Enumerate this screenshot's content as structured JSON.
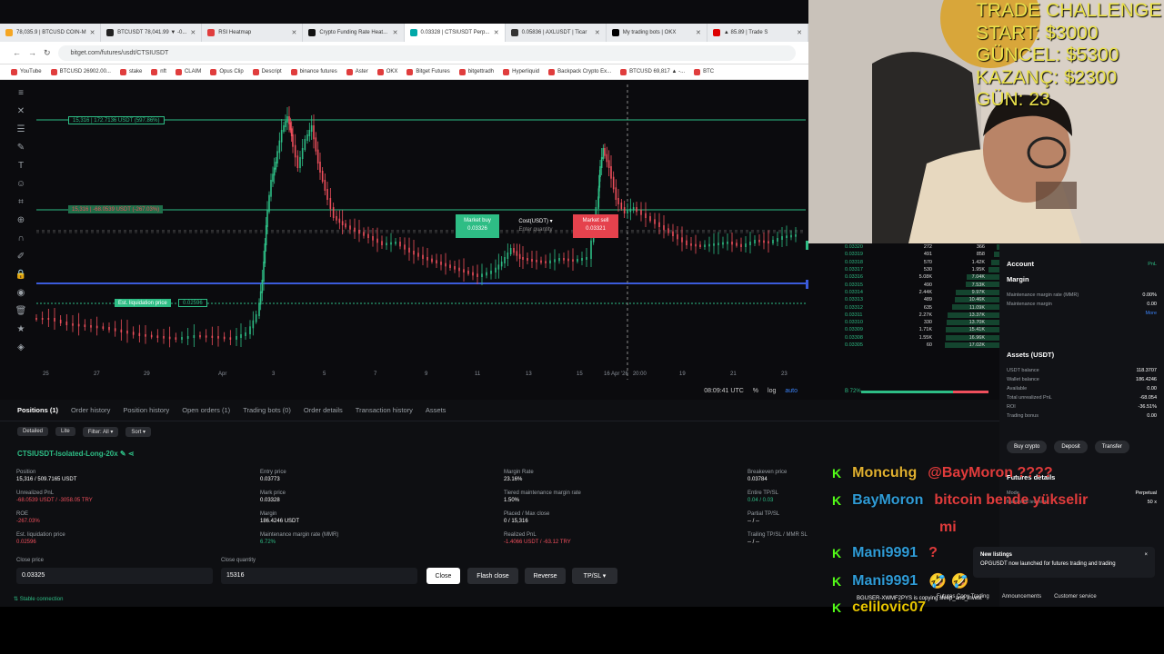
{
  "browser": {
    "tabs": [
      {
        "label": "78,035.9 | BTCUSD COIN-M",
        "color": "#f5a623"
      },
      {
        "label": "BTCUSDT 78,041.99 ▼ -0...",
        "color": "#222"
      },
      {
        "label": "RSI Heatmap",
        "color": "#e03d3d"
      },
      {
        "label": "Crypto Funding Rate Heat...",
        "color": "#111"
      },
      {
        "label": "0.03328 | CTSIUSDT Perp...",
        "color": "#00a8a8"
      },
      {
        "label": "0.05836 | AXLUSDT | Ticar",
        "color": "#333"
      },
      {
        "label": "My trading bots | OKX",
        "color": "#000"
      },
      {
        "label": "▲ 85.89 | Trade S",
        "color": "#d00"
      }
    ],
    "url": "bitget.com/futures/usdt/CTSIUSDT",
    "bookmarks": [
      "YouTube",
      "BTCUSD 26902.00...",
      "stake",
      "nft",
      "CLAIM",
      "Opus Clip",
      "Descript",
      "binance futures",
      "Aster",
      "OKX",
      "Bitget Futures",
      "bitgettradh",
      "Hyperliquid",
      "Backpack Crypto Ex...",
      "BTCUSD 69,817 ▲ -...",
      "BTC"
    ]
  },
  "chart": {
    "tp_tag": "15,316 | 172.7136 USDT (597.86%)",
    "sl_tag": "15,316 | -68.0539 USDT (-267.03%)",
    "liq_tag": "Est. liquidation price",
    "liq_value": "0.02596",
    "price_labels": [
      "0.03320",
      "0.03200",
      "0.02849",
      "0.02596",
      "0.02480",
      "0.02400",
      "0.02320",
      "0.02200"
    ],
    "x_labels": [
      "25",
      "27",
      "29",
      "Apr",
      "3",
      "5",
      "7",
      "9",
      "11",
      "13",
      "15",
      "16 Apr '26   20:00",
      "19",
      "21",
      "23"
    ],
    "market_buy": "Market buy",
    "market_buy_price": "0.03326",
    "cost_label": "Cost(USDT) ▾",
    "cost_placeholder": "Enter quantity",
    "market_sell": "Market sell",
    "market_sell_price": "0.03321",
    "time": "08:09:41 UTC",
    "pct": "%",
    "log": "log",
    "auto": "auto"
  },
  "orderbook": {
    "rows": [
      [
        "0.03320",
        "272",
        "366",
        0.05
      ],
      [
        "0.03319",
        "491",
        "858",
        0.1
      ],
      [
        "0.03318",
        "570",
        "1.42K",
        0.15
      ],
      [
        "0.03317",
        "530",
        "1.95K",
        0.2
      ],
      [
        "0.03316",
        "5.08K",
        "7.04K",
        0.6
      ],
      [
        "0.03315",
        "490",
        "7.53K",
        0.62
      ],
      [
        "0.03314",
        "2.44K",
        "9.97K",
        0.8
      ],
      [
        "0.03313",
        "489",
        "10.46K",
        0.82
      ],
      [
        "0.03312",
        "635",
        "11.09K",
        0.86
      ],
      [
        "0.03311",
        "2.27K",
        "13.37K",
        0.95
      ],
      [
        "0.03310",
        "330",
        "13.70K",
        0.96
      ],
      [
        "0.03309",
        "1.71K",
        "15.41K",
        0.98
      ],
      [
        "0.03308",
        "1.55K",
        "16.96K",
        0.99
      ],
      [
        "0.03305",
        "60",
        "17.02K",
        1.0
      ]
    ],
    "ratio": "B 72%"
  },
  "account": {
    "title": "Account",
    "pnl": "PnL",
    "margin_title": "Margin",
    "mmr_label": "Maintenance margin rate (MMR)",
    "mmr_value": "0.00%",
    "mm_label": "Maintenance margin",
    "mm_value": "0.00",
    "more": "More",
    "assets_title": "Assets (USDT)",
    "rows": [
      [
        "USDT balance",
        "118.3707"
      ],
      [
        "Wallet balance",
        "186.4246"
      ],
      [
        "Available",
        "0.00"
      ],
      [
        "Total unrealized PnL",
        "-68.054"
      ],
      [
        "ROI",
        "-36.51%"
      ],
      [
        "Trading bonus",
        "0.00"
      ]
    ],
    "buttons": [
      "Buy crypto",
      "Deposit",
      "Transfer"
    ],
    "futures_title": "Futures details",
    "futures_rows": [
      [
        "Mode",
        "Perpetual"
      ],
      [
        "Maximum leverage",
        "50 x"
      ]
    ]
  },
  "positions": {
    "tabs": [
      "Positions (1)",
      "Order history",
      "Position history",
      "Open orders (1)",
      "Trading bots (0)",
      "Order details",
      "Transaction history",
      "Assets"
    ],
    "filters": [
      "Detailed",
      "Lite",
      "Filter: All ▾",
      "Sort ▾"
    ],
    "symbol": "CTSIUSDT-Isolated-Long-20x",
    "fields": {
      "position_label": "Position",
      "position_value": "15,316 / 509.7165 USDT",
      "upnl_label": "Unrealized PnL",
      "upnl_value": "-68.0539 USDT / -3058.05 TRY",
      "roe_label": "ROE",
      "roe_value": "-267.03%",
      "liq_label": "Est. liquidation price",
      "liq_value": "0.02596",
      "entry_label": "Entry price",
      "entry_value": "0.03773",
      "mark_label": "Mark price",
      "mark_value": "0.03328",
      "margin_label": "Margin",
      "margin_value": "186.4246 USDT",
      "mmr_label": "Maintenance margin rate (MMR)",
      "mmr_value": "6.72%",
      "mr_label": "Margin Rate",
      "mr_value": "23.16%",
      "tier_label": "Tiered maintenance margin rate",
      "tier_value": "1.50%",
      "placed_label": "Placed / Max close",
      "placed_value": "0 / 15,316",
      "rpnl_label": "Realized PnL",
      "rpnl_value": "-1.4066 USDT / -63.12 TRY",
      "be_label": "Breakeven price",
      "be_value": "0.03784",
      "tpsl_label": "Entire TP/SL",
      "tpsl_value": "0.04 / 0.03",
      "ptpsl_label": "Partial TP/SL",
      "ptpsl_value": "-- / --",
      "trail_label": "Trailing TP/SL / MMR SL",
      "trail_value": "-- / --"
    },
    "close_price_label": "Close price",
    "close_price_value": "0.03325",
    "close_qty_label": "Close quantity",
    "close_qty_value": "15316",
    "buttons": [
      "Close",
      "Flash close",
      "Reverse",
      "TP/SL ▾"
    ],
    "stable": "Stable connection"
  },
  "footer": [
    "Futures Copy Trading",
    "Announcements",
    "Customer service"
  ],
  "overlay": {
    "line1": "TRADE CHALLENGE",
    "line2": "START: $3000",
    "line3": "GÜNCEL: $5300",
    "line4": "KAZANÇ: $2300",
    "line5": "GÜN: 23"
  },
  "chat": [
    {
      "user": "Moncuhg",
      "msg": "@BayMoron ????",
      "color": "#e0b030"
    },
    {
      "user": "BayMoron",
      "msg": "bitcoin bende yükselir",
      "color": "#2f9bd6"
    },
    {
      "user": "",
      "msg": "mi",
      "color": ""
    },
    {
      "user": "Mani9991",
      "msg": "?",
      "color": "#2f9bd6"
    },
    {
      "user": "Mani9991",
      "msg": "🤣 🤣",
      "color": "#2f9bd6"
    },
    {
      "user": "celilovic07",
      "msg": "",
      "color": "#e6c400"
    }
  ],
  "toast": {
    "title": "New listings",
    "body": "OPGUSDT now launched for futures trading and trading",
    "system": "BGUSER-XWMF2PYS is copying sleep_and_invest"
  }
}
